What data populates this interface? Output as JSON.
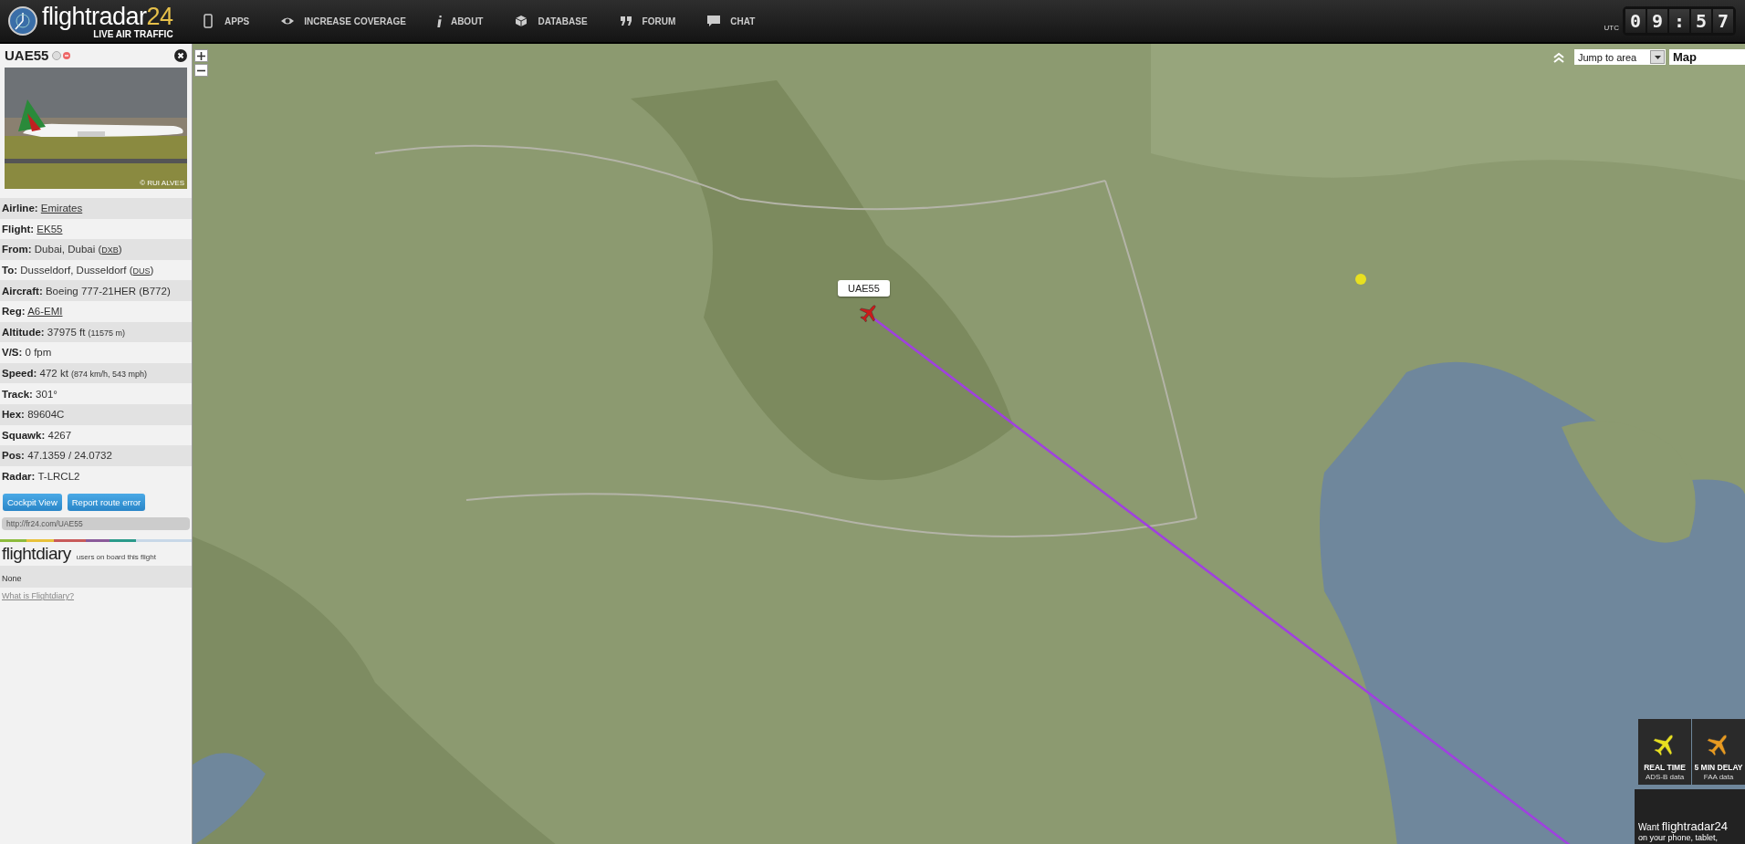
{
  "header": {
    "logo": {
      "word": "flightradar",
      "number": "24",
      "tagline": "LIVE AIR TRAFFIC"
    },
    "nav": [
      {
        "label": "APPS",
        "kind": "phone"
      },
      {
        "label": "INCREASE COVERAGE",
        "kind": "eye"
      },
      {
        "label": "ABOUT",
        "kind": "info"
      },
      {
        "label": "DATABASE",
        "kind": "box"
      },
      {
        "label": "FORUM",
        "kind": "quote"
      },
      {
        "label": "CHAT",
        "kind": "chat"
      }
    ],
    "clock": {
      "zone": "UTC",
      "digits": [
        "0",
        "9",
        ":",
        "5",
        "7"
      ]
    }
  },
  "flight_panel": {
    "callsign": "UAE55",
    "photo_credit": "© RUI ALVES",
    "rows": [
      {
        "label": "Airline:",
        "parts": [
          {
            "text": "Emirates",
            "kind": "link"
          }
        ]
      },
      {
        "label": "Flight:",
        "parts": [
          {
            "text": "EK55",
            "kind": "link"
          }
        ]
      },
      {
        "label": "From:",
        "parts": [
          {
            "text": "Dubai, Dubai (",
            "kind": "text"
          },
          {
            "text": "DXB",
            "kind": "code"
          },
          {
            "text": ")",
            "kind": "text"
          }
        ]
      },
      {
        "label": "To:",
        "parts": [
          {
            "text": "Dusseldorf, Dusseldorf (",
            "kind": "text"
          },
          {
            "text": "DUS",
            "kind": "code"
          },
          {
            "text": ")",
            "kind": "text"
          }
        ]
      },
      {
        "label": "Aircraft:",
        "parts": [
          {
            "text": "Boeing 777-21HER (B772)",
            "kind": "text"
          }
        ]
      },
      {
        "label": "Reg:",
        "parts": [
          {
            "text": "A6-EMI",
            "kind": "link"
          }
        ]
      },
      {
        "label": "Altitude:",
        "parts": [
          {
            "text": "37975 ft ",
            "kind": "text"
          },
          {
            "text": "(11575 m)",
            "kind": "small"
          }
        ]
      },
      {
        "label": "V/S:",
        "parts": [
          {
            "text": "0 fpm",
            "kind": "text"
          }
        ]
      },
      {
        "label": "Speed:",
        "parts": [
          {
            "text": "472 kt ",
            "kind": "text"
          },
          {
            "text": "(874 km/h, 543 mph)",
            "kind": "small"
          }
        ]
      },
      {
        "label": "Track:",
        "parts": [
          {
            "text": "301°",
            "kind": "text"
          }
        ]
      },
      {
        "label": "Hex:",
        "parts": [
          {
            "text": "89604C",
            "kind": "text"
          }
        ]
      },
      {
        "label": "Squawk:",
        "parts": [
          {
            "text": "4267",
            "kind": "text"
          }
        ]
      },
      {
        "label": "Pos:",
        "parts": [
          {
            "text": "47.1359 / 24.0732",
            "kind": "text"
          }
        ]
      },
      {
        "label": "Radar:",
        "parts": [
          {
            "text": "T-LRCL2",
            "kind": "text"
          }
        ]
      }
    ],
    "buttons": [
      "Cockpit View",
      "Report route error"
    ],
    "share_url": "http://fr24.com/UAE55",
    "diary": {
      "logo": "flightdiary",
      "caption": "users on board this flight",
      "value": "None",
      "link": "What is Flightdiary?"
    }
  },
  "map": {
    "kind": "picture",
    "jump_select": "Jump to area",
    "type_select": "Map",
    "selected_flight": "UAE55",
    "legend": [
      {
        "title": "REAL TIME",
        "sub": "ADS-B data",
        "color": "#e8e020"
      },
      {
        "title": "5 MIN DELAY",
        "sub": "FAA data",
        "color": "#e89a20"
      }
    ],
    "promo": {
      "lead": "Want ",
      "brand": "flightradar24",
      "line2": "on your phone, tablet,"
    }
  }
}
